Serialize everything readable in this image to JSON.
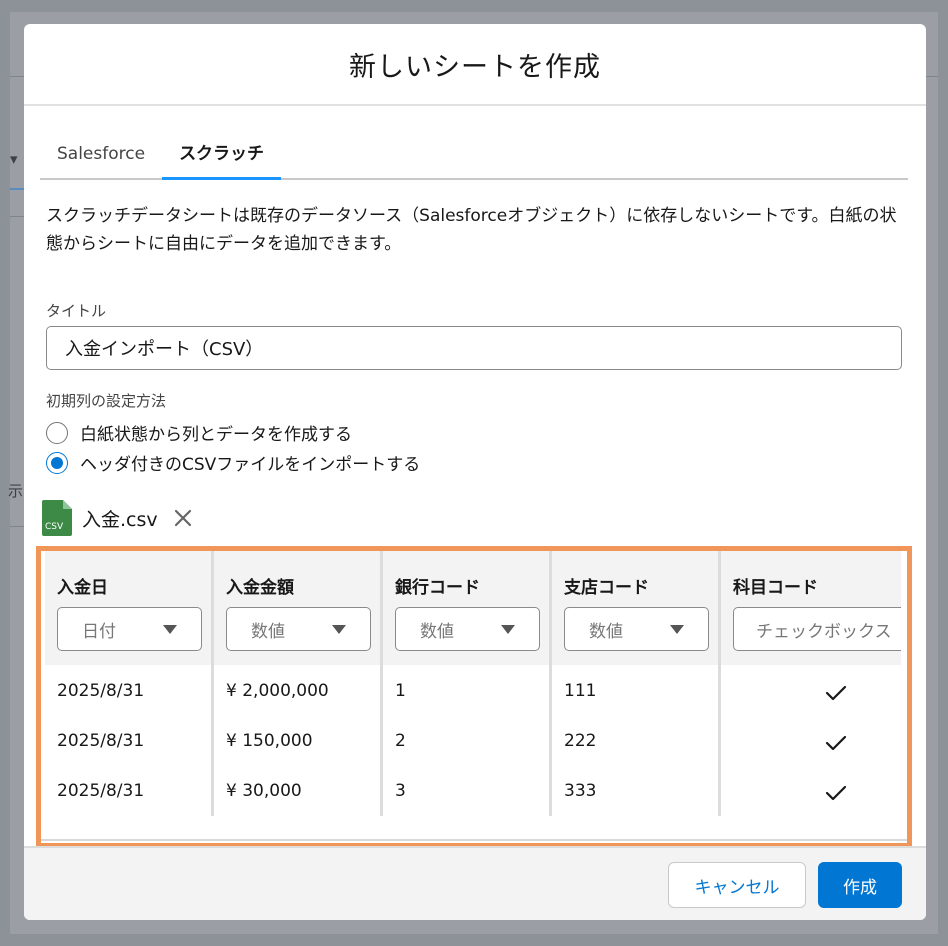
{
  "modal": {
    "title": "新しいシートを作成",
    "tabs": [
      {
        "label": "Salesforce",
        "active": false
      },
      {
        "label": "スクラッチ",
        "active": true
      }
    ],
    "description": "スクラッチデータシートは既存のデータソース（Salesforceオブジェクト）に依存しないシートです。白紙の状態からシートに自由にデータを追加できます。",
    "title_field": {
      "label": "タイトル",
      "value": "入金インポート（CSV）"
    },
    "init_method": {
      "label": "初期列の設定方法",
      "options": [
        {
          "label": "白紙状態から列とデータを作成する",
          "checked": false
        },
        {
          "label": "ヘッダ付きのCSVファイルをインポートする",
          "checked": true
        }
      ]
    },
    "file": {
      "name": "入金.csv",
      "icon_label": "CSV",
      "icon": "csv-file-icon",
      "color": "#3c8a46"
    },
    "table": {
      "columns": [
        {
          "header": "入金日",
          "type": "日付"
        },
        {
          "header": "入金金額",
          "type": "数値"
        },
        {
          "header": "銀行コード",
          "type": "数値"
        },
        {
          "header": "支店コード",
          "type": "数値"
        },
        {
          "header": "科目コード",
          "type": "チェックボックス"
        }
      ],
      "rows": [
        [
          "2025/8/31",
          "¥ 2,000,000",
          "1",
          "111",
          true
        ],
        [
          "2025/8/31",
          "¥ 150,000",
          "2",
          "222",
          true
        ],
        [
          "2025/8/31",
          "¥ 30,000",
          "3",
          "333",
          true
        ]
      ]
    },
    "footer": {
      "cancel_label": "キャンセル",
      "create_label": "作成"
    }
  },
  "colors": {
    "accent": "#0176d3",
    "tab_indicator": "#1b96ff",
    "highlight_border": "#ef9658"
  }
}
